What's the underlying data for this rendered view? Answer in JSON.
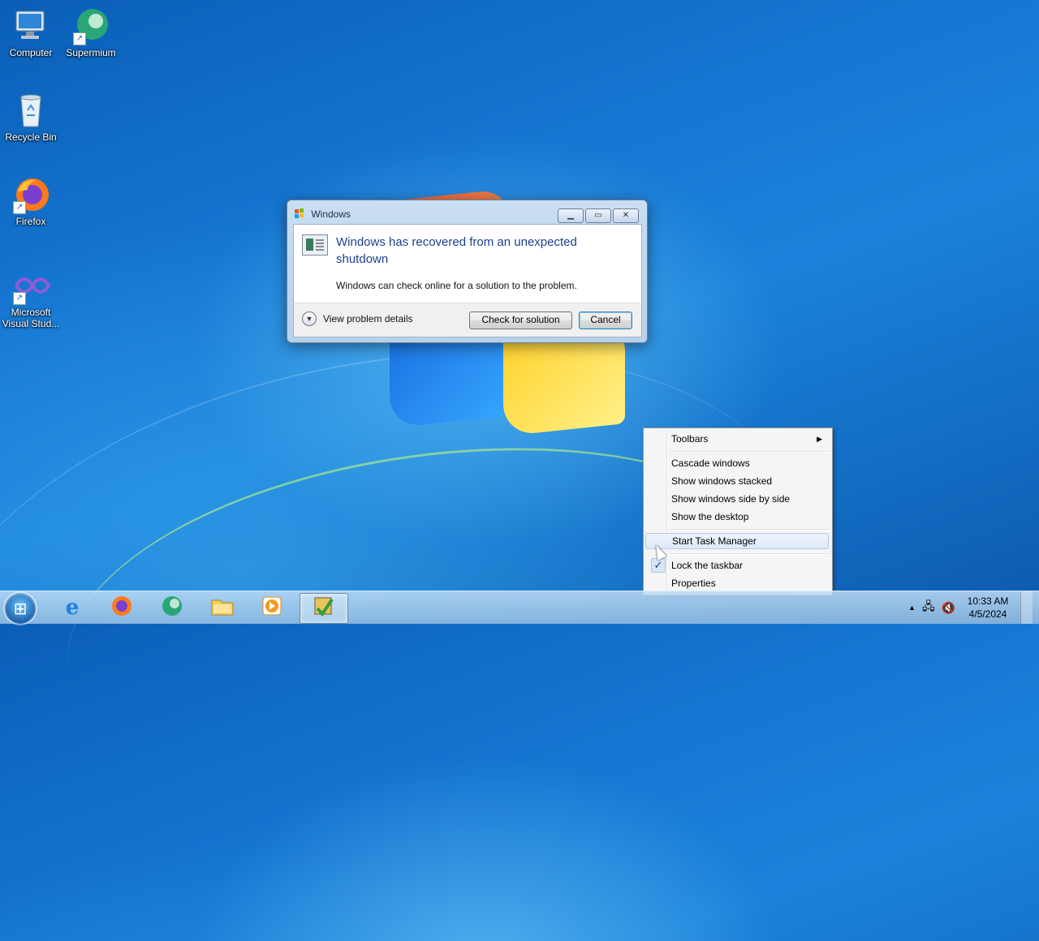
{
  "desktop": {
    "icons": [
      {
        "label": "Computer",
        "icon": "computer-icon"
      },
      {
        "label": "Supermium",
        "icon": "supermium-icon"
      },
      {
        "label": "Recycle Bin",
        "icon": "recycle-bin-icon"
      },
      {
        "label": "Firefox",
        "icon": "firefox-icon"
      },
      {
        "label": "Microsoft Visual Stud...",
        "icon": "visual-studio-icon"
      }
    ]
  },
  "dialog": {
    "title": "Windows",
    "heading": "Windows has recovered from an unexpected shutdown",
    "message": "Windows can check online for a solution to the problem.",
    "details_label": "View problem details",
    "check_button": "Check for solution",
    "cancel_button": "Cancel"
  },
  "context_menu": {
    "items": [
      {
        "label": "Toolbars",
        "submenu": true
      },
      {
        "label": "Cascade windows"
      },
      {
        "label": "Show windows stacked"
      },
      {
        "label": "Show windows side by side"
      },
      {
        "label": "Show the desktop"
      },
      {
        "label": "Start Task Manager",
        "highlighted": true
      },
      {
        "label": "Lock the taskbar",
        "checked": true
      },
      {
        "label": "Properties"
      }
    ]
  },
  "taskbar": {
    "pinned": [
      "internet-explorer-icon",
      "firefox-icon",
      "supermium-icon",
      "file-explorer-icon",
      "media-player-icon",
      "problem-reports-icon"
    ],
    "clock": {
      "time": "10:33 AM",
      "date": "4/5/2024"
    }
  },
  "colors": {
    "dialog_heading": "#1b3f8f",
    "taskbar": "#a8c8e6",
    "desktop": "#1677d2"
  }
}
